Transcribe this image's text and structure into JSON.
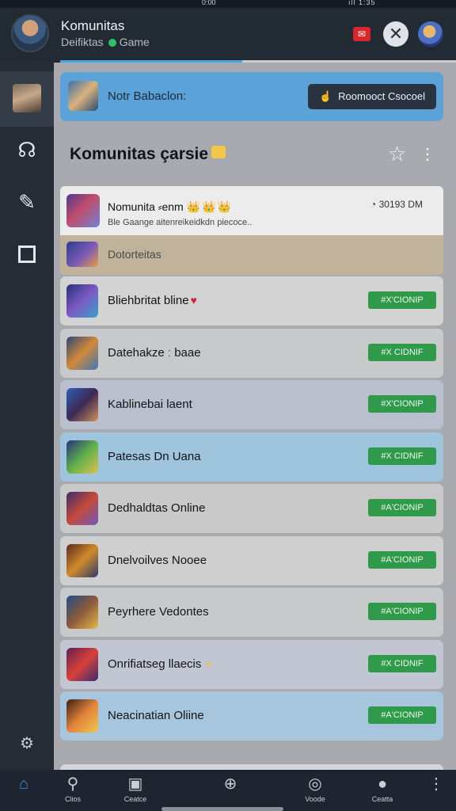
{
  "statusbar": {
    "time": "0:00",
    "right": "ıll 1:35"
  },
  "header": {
    "title": "Komunitas",
    "subtitle_left": "Deifiktas",
    "subtitle_right": "Game"
  },
  "banner": {
    "text": "Notr Babaclon:",
    "button_label": "Roomooct Csocoel"
  },
  "section": {
    "title": "Komunitas çarsie"
  },
  "featured": {
    "name": "Nomunita ⸗enm",
    "badges": "👑👑👑",
    "description": "Ble Gaange aitenreikeidkdn piecoce..",
    "time": "30193 DM",
    "subrow_label": "Dotorteitas"
  },
  "rows": [
    {
      "name": "Bliehbritat bline",
      "extra": "♥",
      "action": "#X'CIONIP",
      "bg": "#d3d3d3",
      "thumb": [
        "#27307a",
        "#7d5ac4",
        "#35a3c9"
      ]
    },
    {
      "name": "Datehakze ː baae",
      "extra": "",
      "action": "#X CIDNIF",
      "bg": "#c8c9cb",
      "thumb": [
        "#2c4576",
        "#d18a3a",
        "#3f76b7"
      ]
    },
    {
      "name": "Kablinebai laent",
      "extra": "",
      "action": "#X'CIONIP",
      "bg": "#b9bfcd",
      "thumb": [
        "#2e5fb7",
        "#3b2a54",
        "#d18f5a"
      ]
    },
    {
      "name": "Patesas Dn Uana",
      "extra": "",
      "action": "#X CIDNIF",
      "bg": "#9ec5dd",
      "thumb": [
        "#27307a",
        "#5fb04d",
        "#e0c050"
      ]
    },
    {
      "name": "Dedhaldtas Online",
      "extra": "",
      "action": "#A'CIONIP",
      "bg": "#c9c9c9",
      "thumb": [
        "#3a2b6f",
        "#c44a3a",
        "#6d5ac0"
      ]
    },
    {
      "name": "Dnelvoilves Nooee",
      "extra": "",
      "action": "#A'CIONIP",
      "bg": "#cfcfcf",
      "thumb": [
        "#5a2a1e",
        "#d08a2a",
        "#2d3a6b"
      ]
    },
    {
      "name": "Peyrhere Vedontes",
      "extra": "",
      "action": "#A'CIONIP",
      "bg": "#c8c9cb",
      "thumb": [
        "#1f4d8a",
        "#8a5a3a",
        "#e5b84a"
      ]
    },
    {
      "name": "Onrifiatseg llaecis",
      "extra": "✦",
      "action": "#X CIDNIF",
      "bg": "#c2c6d3",
      "thumb": [
        "#5b1f52",
        "#d8413a",
        "#3a2a70"
      ]
    },
    {
      "name": "Neacinatian Oliine",
      "extra": "",
      "action": "#A'CIONIP",
      "bg": "#a7c6de",
      "thumb": [
        "#3a1e14",
        "#e0833a",
        "#f2c84f"
      ]
    }
  ],
  "bottom_nav": [
    {
      "label": "",
      "icon": "home-icon",
      "glyph": "⌂"
    },
    {
      "label": "Clios",
      "icon": "search-icon",
      "glyph": "⚲"
    },
    {
      "label": "Ceatce",
      "icon": "gift-icon",
      "glyph": "▣"
    },
    {
      "label": "",
      "icon": "compass-icon",
      "glyph": "⊕"
    },
    {
      "label": "Voode",
      "icon": "chat-icon",
      "glyph": "◎"
    },
    {
      "label": "Ceatta",
      "icon": "profile-icon",
      "glyph": "●"
    },
    {
      "label": "",
      "icon": "more-icon",
      "glyph": "⋮"
    }
  ],
  "colors": {
    "accent": "#4ba3e2",
    "join": "#2f9a4a",
    "banner": "#5aa2d8"
  },
  "progress": {
    "fraction": 0.46
  }
}
